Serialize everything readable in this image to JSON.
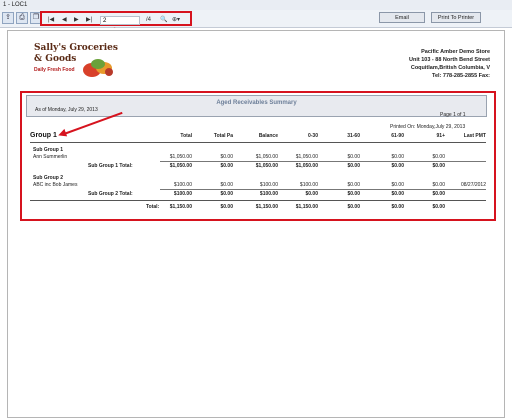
{
  "window": {
    "tab_title": "1 - LOC1"
  },
  "toolbar": {
    "page_value": "2",
    "page_total": "/4",
    "email_label": "Email",
    "print_label": "Print To Printer",
    "icons": [
      "export-icon",
      "print-icon",
      "copy-icon",
      "first-page-icon",
      "prev-page-icon",
      "next-page-icon",
      "last-page-icon",
      "search-icon",
      "zoom-icon"
    ]
  },
  "logo": {
    "line1": "Sally's Groceries",
    "line2": "& Goods",
    "tagline": "Daily Fresh Food"
  },
  "store": {
    "name": "Pacific Amber Demo Store",
    "address1": "Unit 103 - 88 North Bend Street",
    "address2": "Coquitlam,British Columbia, V",
    "phone": "Tel: 778-285-2855  Fax:"
  },
  "report": {
    "title": "Aged Receivables Summary",
    "as_of": "As of Monday, July 29, 2013",
    "page_info": "Page 1 of 1",
    "printed_on": "Printed On: Monday,July 29, 2013",
    "group_title": "Group 1",
    "columns": [
      "Total",
      "Total Pa",
      "Balance",
      "0-30",
      "31-60",
      "61-90",
      "91+",
      "Last PMT"
    ],
    "subgroups": [
      {
        "title": "Sub Group 1",
        "customer": "Ann Summerlin",
        "row": [
          "$1,050.00",
          "$0.00",
          "$1,050.00",
          "$1,050.00",
          "$0.00",
          "$0.00",
          "$0.00",
          ""
        ],
        "total_label": "Sub Group  1  Total:",
        "total": [
          "$1,050.00",
          "$0.00",
          "$1,050.00",
          "$1,050.00",
          "$0.00",
          "$0.00",
          "$0.00"
        ]
      },
      {
        "title": "Sub Group 2",
        "customer": "ABC inc Bob James",
        "row": [
          "$100.00",
          "$0.00",
          "$100.00",
          "$100.00",
          "$0.00",
          "$0.00",
          "$0.00",
          "08/27/2012"
        ],
        "total_label": "Sub Group  2  Total:",
        "total": [
          "$100.00",
          "$0.00",
          "$100.00",
          "$0.00",
          "$0.00",
          "$0.00",
          "$0.00"
        ]
      }
    ],
    "grand_total_label": "Total:",
    "grand_total": [
      "$1,150.00",
      "$0.00",
      "$1,150.00",
      "$1,150.00",
      "$0.00",
      "$0.00",
      "$0.00"
    ]
  }
}
